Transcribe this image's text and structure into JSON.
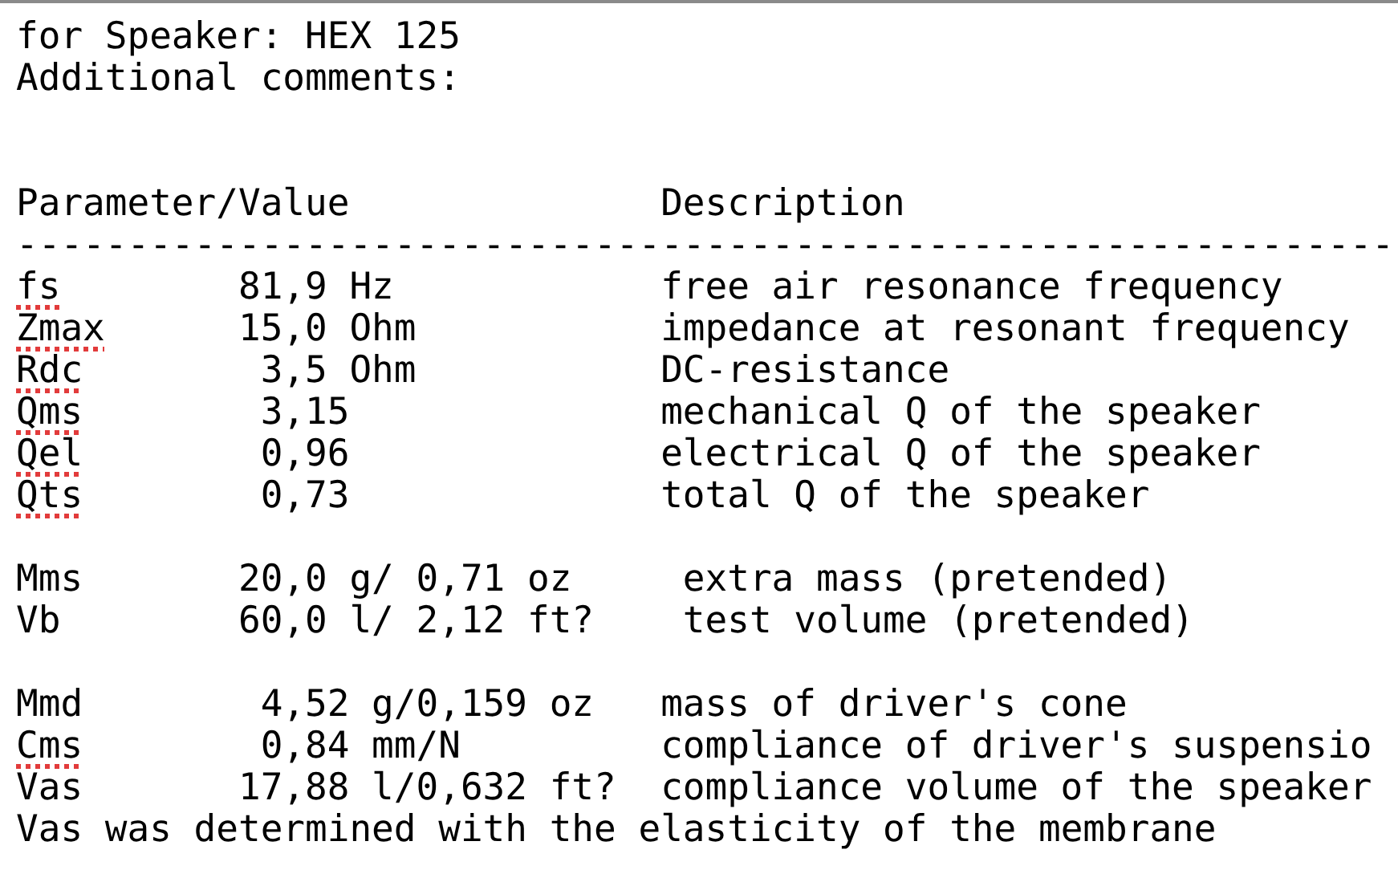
{
  "heading_lines": [
    "for Speaker: HEX 125",
    "Additional comments:"
  ],
  "table": {
    "columns": [
      "Parameter/Value",
      "Description"
    ],
    "rule": "--------------------------------------------------------------",
    "groups": [
      {
        "rows": [
          {
            "parameter": "fs",
            "misspelled": true,
            "value": "81,9 Hz",
            "description": "free air resonance frequency"
          },
          {
            "parameter": "Zmax",
            "misspelled": true,
            "value": "15,0 Ohm",
            "description": "impedance at resonant frequency"
          },
          {
            "parameter": "Rdc",
            "misspelled": true,
            "value": " 3,5 Ohm",
            "description": "DC-resistance"
          },
          {
            "parameter": "Qms",
            "misspelled": true,
            "value": " 3,15",
            "description": "mechanical Q of the speaker"
          },
          {
            "parameter": "Qel",
            "misspelled": true,
            "value": " 0,96",
            "description": "electrical Q of the speaker"
          },
          {
            "parameter": "Qts",
            "misspelled": true,
            "value": " 0,73",
            "description": "total Q of the speaker"
          }
        ]
      },
      {
        "rows": [
          {
            "parameter": "Mms",
            "misspelled": false,
            "value": "20,0 g/ 0,71 oz",
            "description": " extra mass (pretended)"
          },
          {
            "parameter": "Vb",
            "misspelled": false,
            "value": "60,0 l/ 2,12 ft?",
            "description": " test volume (pretended)"
          }
        ]
      },
      {
        "rows": [
          {
            "parameter": "Mmd",
            "misspelled": false,
            "value": " 4,52 g/0,159 oz",
            "description": "mass of driver's cone"
          },
          {
            "parameter": "Cms",
            "misspelled": true,
            "value": " 0,84 mm/N",
            "description": "compliance of driver's suspensio"
          },
          {
            "parameter": "Vas",
            "misspelled": false,
            "value": "17,88 l/0,632 ft?",
            "description": "compliance volume of the speaker"
          }
        ]
      }
    ]
  },
  "footnote": "Vas was determined with the elasticity of the membrane"
}
